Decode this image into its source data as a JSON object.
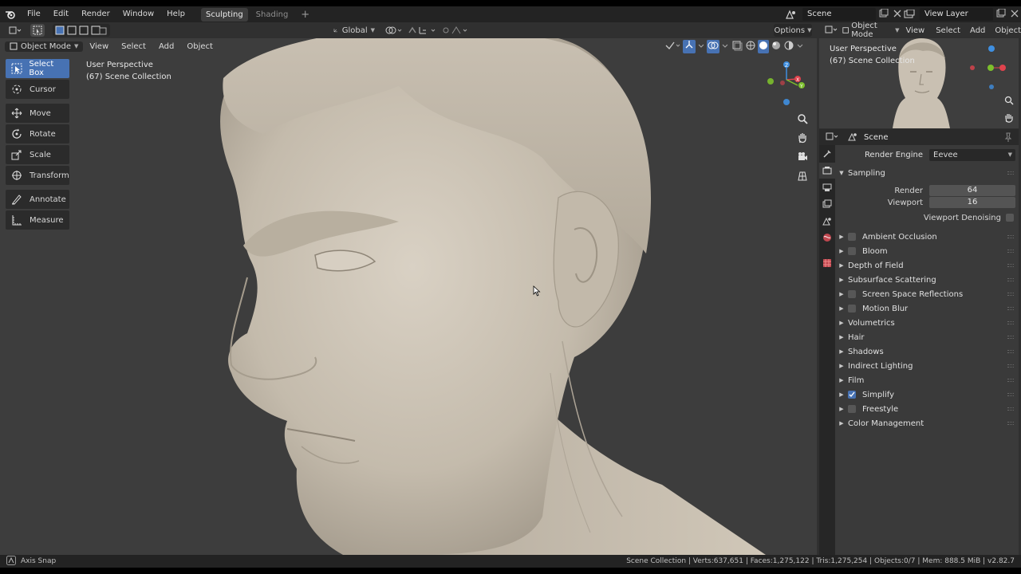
{
  "topbar": {
    "menus": [
      "File",
      "Edit",
      "Render",
      "Window",
      "Help"
    ],
    "workspaces": [
      {
        "label": "Sculpting",
        "active": true
      },
      {
        "label": "Shading",
        "active": false
      }
    ],
    "scene": "Scene",
    "view_layer": "View Layer"
  },
  "header": {
    "transform_orientation": "Global",
    "options_label": "Options"
  },
  "viewport": {
    "mode": "Object Mode",
    "menus": [
      "View",
      "Select",
      "Add",
      "Object"
    ],
    "info_line1": "User Perspective",
    "info_line2": "(67) Scene Collection",
    "background_color": "#3d3d3d",
    "sculpt_color": "#c9c0b2"
  },
  "toolbar": {
    "tools": [
      {
        "label": "Select Box",
        "icon": "select-box-icon",
        "active": true
      },
      {
        "label": "Cursor",
        "icon": "cursor-icon",
        "active": false
      },
      {
        "label": "Move",
        "icon": "move-icon",
        "active": false
      },
      {
        "label": "Rotate",
        "icon": "rotate-icon",
        "active": false
      },
      {
        "label": "Scale",
        "icon": "scale-icon",
        "active": false
      },
      {
        "label": "Transform",
        "icon": "transform-icon",
        "active": false
      },
      {
        "label": "Annotate",
        "icon": "annotate-icon",
        "active": false
      },
      {
        "label": "Measure",
        "icon": "measure-icon",
        "active": false
      }
    ]
  },
  "mini_viewport": {
    "mode": "Object Mode",
    "menus": [
      "View",
      "Select",
      "Add",
      "Object"
    ],
    "info_line1": "User Perspective",
    "info_line2": "(67) Scene Collection"
  },
  "properties": {
    "context": "Scene",
    "render_engine_label": "Render Engine",
    "render_engine_value": "Eevee",
    "sampling": {
      "title": "Sampling",
      "render_label": "Render",
      "render_value": "64",
      "viewport_label": "Viewport",
      "viewport_value": "16",
      "denoise_label": "Viewport Denoising",
      "denoise_checked": false
    },
    "panels": [
      {
        "label": "Ambient Occlusion",
        "has_checkbox": true,
        "checked": false
      },
      {
        "label": "Bloom",
        "has_checkbox": true,
        "checked": false
      },
      {
        "label": "Depth of Field",
        "has_checkbox": false,
        "checked": false
      },
      {
        "label": "Subsurface Scattering",
        "has_checkbox": false,
        "checked": false
      },
      {
        "label": "Screen Space Reflections",
        "has_checkbox": true,
        "checked": false
      },
      {
        "label": "Motion Blur",
        "has_checkbox": true,
        "checked": false
      },
      {
        "label": "Volumetrics",
        "has_checkbox": false,
        "checked": false
      },
      {
        "label": "Hair",
        "has_checkbox": false,
        "checked": false
      },
      {
        "label": "Shadows",
        "has_checkbox": false,
        "checked": false
      },
      {
        "label": "Indirect Lighting",
        "has_checkbox": false,
        "checked": false
      },
      {
        "label": "Film",
        "has_checkbox": false,
        "checked": false
      },
      {
        "label": "Simplify",
        "has_checkbox": true,
        "checked": true
      },
      {
        "label": "Freestyle",
        "has_checkbox": true,
        "checked": false
      },
      {
        "label": "Color Management",
        "has_checkbox": false,
        "checked": false
      }
    ]
  },
  "status": {
    "left": "Axis Snap",
    "right": "Scene Collection | Verts:637,651 | Faces:1,275,122 | Tris:1,275,254 | Objects:0/7 | Mem: 888.5 MiB | v2.82.7"
  },
  "colors": {
    "accent": "#4772b3",
    "axis_x": "#e0434d",
    "axis_y": "#7cbf2c",
    "axis_z": "#3f8fe0"
  }
}
